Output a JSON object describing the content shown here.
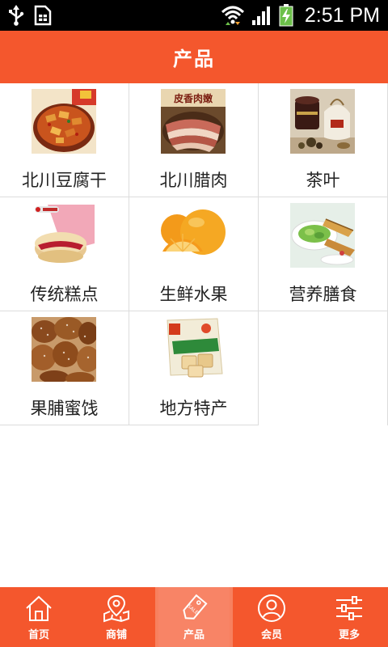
{
  "status_bar": {
    "time": "2:51 PM",
    "icons": [
      "usb-icon",
      "sim-icon",
      "wifi-icon",
      "signal-icon",
      "battery-charging-icon"
    ]
  },
  "header": {
    "title": "产品"
  },
  "products": [
    {
      "label": "北川豆腐干",
      "image": "spicy-tofu-product-image"
    },
    {
      "label": "北川腊肉",
      "image": "cured-pork-product-image",
      "image_text": "皮香肉嫩"
    },
    {
      "label": "茶叶",
      "image": "tea-product-image"
    },
    {
      "label": "传统糕点",
      "image": "pastry-product-image"
    },
    {
      "label": "生鲜水果",
      "image": "orange-fruit-product-image"
    },
    {
      "label": "营养膳食",
      "image": "meal-dish-product-image"
    },
    {
      "label": "果脯蜜饯",
      "image": "candied-fruit-product-image"
    },
    {
      "label": "地方特产",
      "image": "local-specialty-product-image"
    }
  ],
  "bottom_nav": {
    "items": [
      {
        "label": "首页",
        "icon": "home-icon",
        "active": false
      },
      {
        "label": "商铺",
        "icon": "map-store-icon",
        "active": false
      },
      {
        "label": "产品",
        "icon": "sale-tag-icon",
        "active": true
      },
      {
        "label": "会员",
        "icon": "user-icon",
        "active": false
      },
      {
        "label": "更多",
        "icon": "settings-sliders-icon",
        "active": false
      }
    ]
  },
  "colors": {
    "accent": "#f4572d",
    "active_tab": "#f88466",
    "status_bar": "#000000",
    "grid_border": "#dcdcdc"
  }
}
